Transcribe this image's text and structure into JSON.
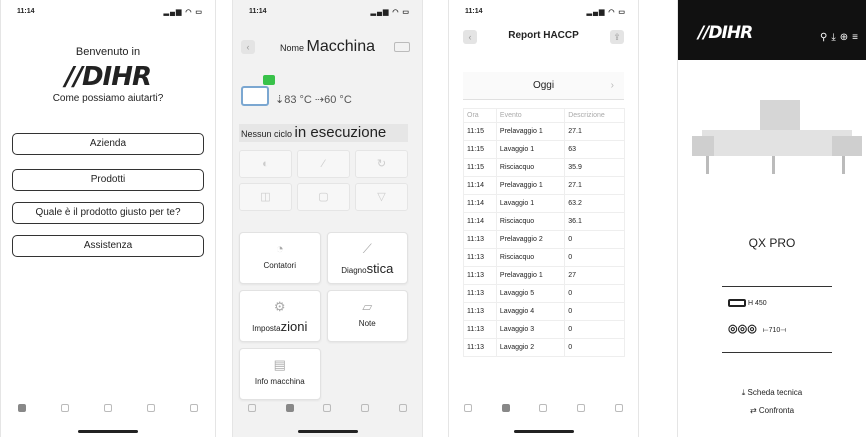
{
  "common": {
    "time": "11:14",
    "status_icons": "▂▄▆ ◠ ▭"
  },
  "screen1": {
    "welcome": "Benvenuto in",
    "logo": "//DIHR",
    "help": "Come possiamo aiutarti?",
    "buttons": [
      "Azienda",
      "Prodotti",
      "Quale è il prodotto giusto per te?",
      "Assistenza"
    ]
  },
  "screen2": {
    "title_prefix": "Nome",
    "title_main": "Macchina",
    "temps": "⇣83 °C ⇢60 °C",
    "cycle_prefix": "Nessun ciclo",
    "cycle_main": "in esecuzione",
    "tiles": {
      "counters": "Contatori",
      "diag_prefix": "Diagno",
      "diag_main": "stica",
      "settings_prefix": "Imposta",
      "settings_main": "zioni",
      "notes": "Note",
      "info": "Info macchina"
    }
  },
  "screen3": {
    "title": "Report HACCP",
    "filter": "Oggi",
    "columns": [
      "Ora",
      "Evento",
      "Descrizione"
    ],
    "rows": [
      [
        "11:15",
        "Prelavaggio 1",
        "27.1"
      ],
      [
        "11:15",
        "Lavaggio 1",
        "63"
      ],
      [
        "11:15",
        "Risciacquo",
        "35.9"
      ],
      [
        "11:14",
        "Prelavaggio 1",
        "27.1"
      ],
      [
        "11:14",
        "Lavaggio 1",
        "63.2"
      ],
      [
        "11:14",
        "Risciacquo",
        "36.1"
      ],
      [
        "11:13",
        "Prelavaggio 2",
        "0"
      ],
      [
        "11:13",
        "Risciacquo",
        "0"
      ],
      [
        "11:13",
        "Prelavaggio 1",
        "27"
      ],
      [
        "11:13",
        "Lavaggio 5",
        "0"
      ],
      [
        "11:13",
        "Lavaggio 4",
        "0"
      ],
      [
        "11:13",
        "Lavaggio 3",
        "0"
      ],
      [
        "11:13",
        "Lavaggio 2",
        "0"
      ]
    ]
  },
  "screen4": {
    "logo": "//DIHR",
    "product": "QX PRO",
    "height": "H 450",
    "width": "710",
    "datasheet": "Scheda tecnica",
    "compare": "Confronta"
  }
}
